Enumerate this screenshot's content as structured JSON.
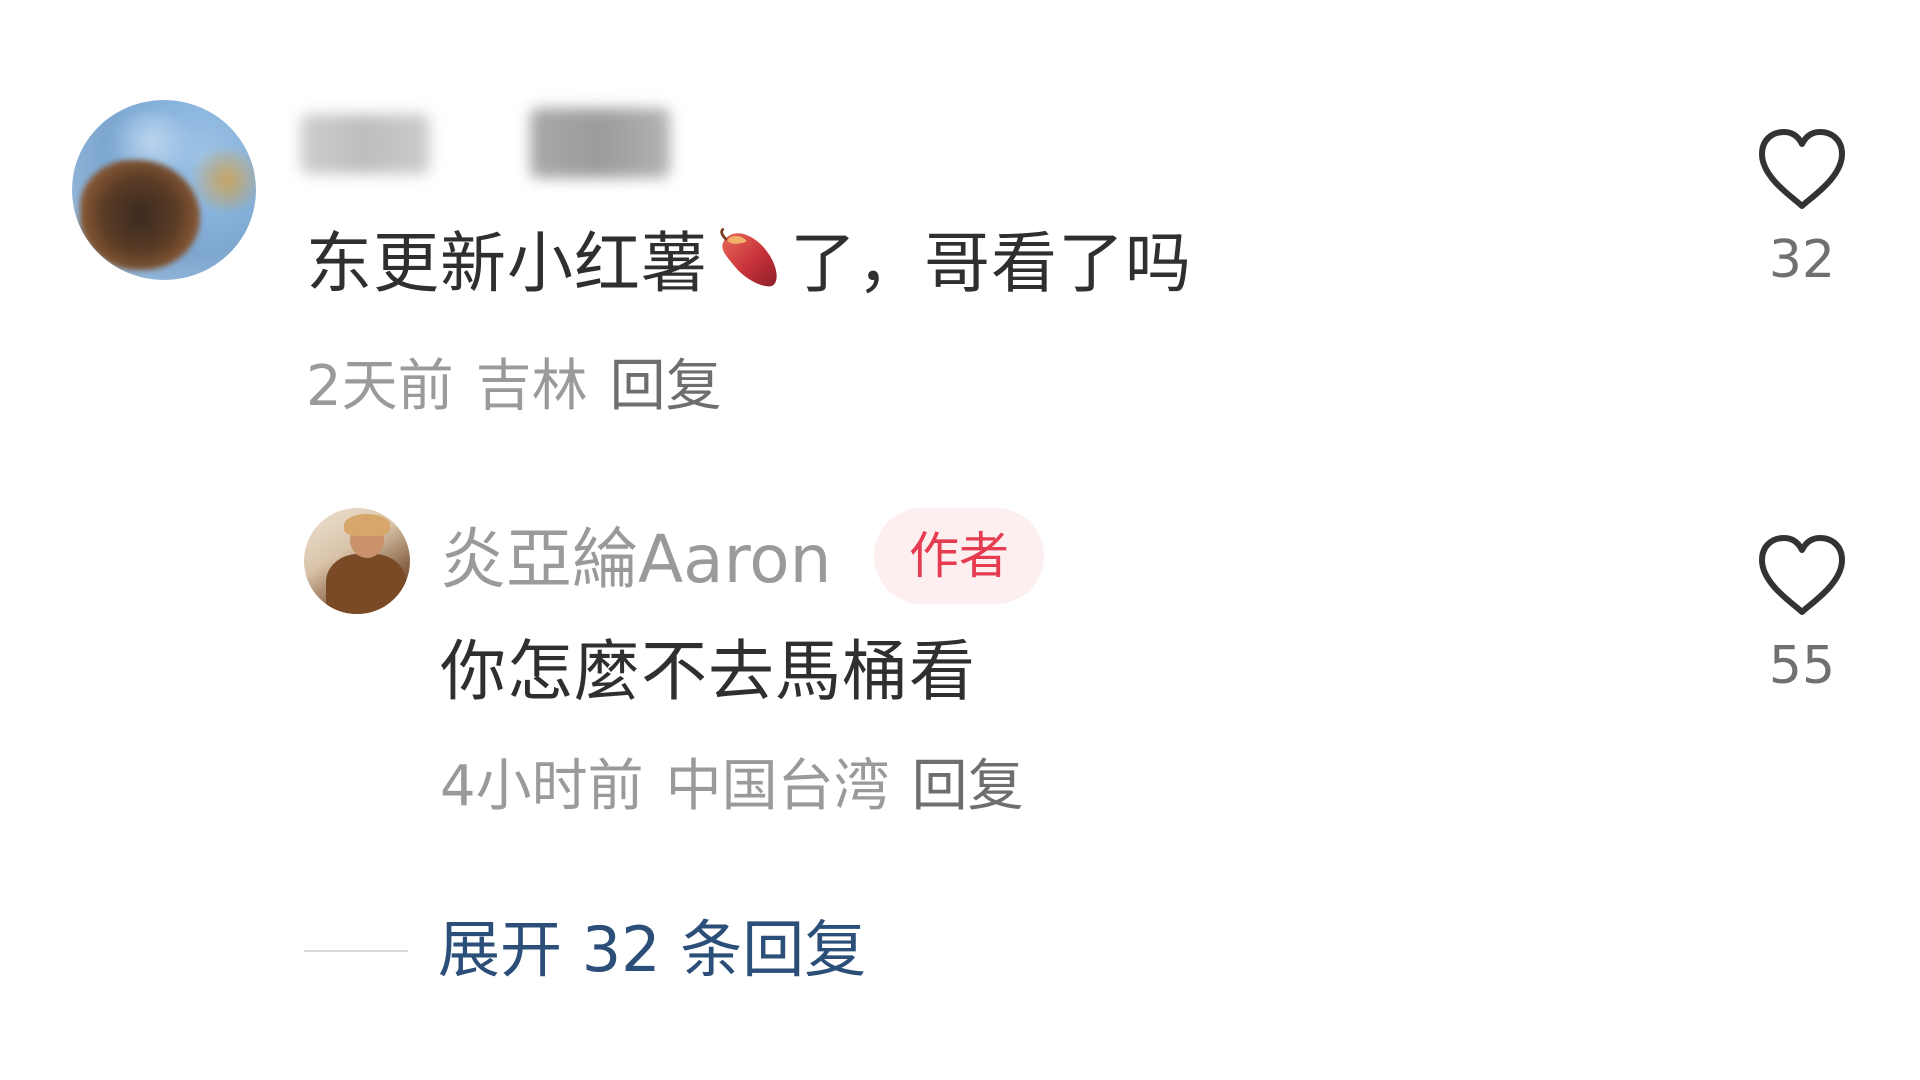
{
  "comment": {
    "text_before_emoji": "东更新小红薯",
    "emoji": "sweet-potato-emoji",
    "text_after_emoji": "了，哥看了吗",
    "time": "2天前",
    "location": "吉林",
    "reply_label": "回复",
    "like_count": "32",
    "like_icon": "heart-outline-icon"
  },
  "reply": {
    "author": "炎亞綸Aaron",
    "badge": "作者",
    "text": "你怎麼不去馬桶看",
    "time": "4小时前",
    "location": "中国台湾",
    "reply_label": "回复",
    "like_count": "55",
    "like_icon": "heart-outline-icon"
  },
  "expand": {
    "label": "展开 32 条回复"
  },
  "colors": {
    "link": "#2b4f78",
    "badge_text": "#e53c52",
    "badge_bg": "#fdeef0",
    "meta_text": "#9a9a9a"
  }
}
